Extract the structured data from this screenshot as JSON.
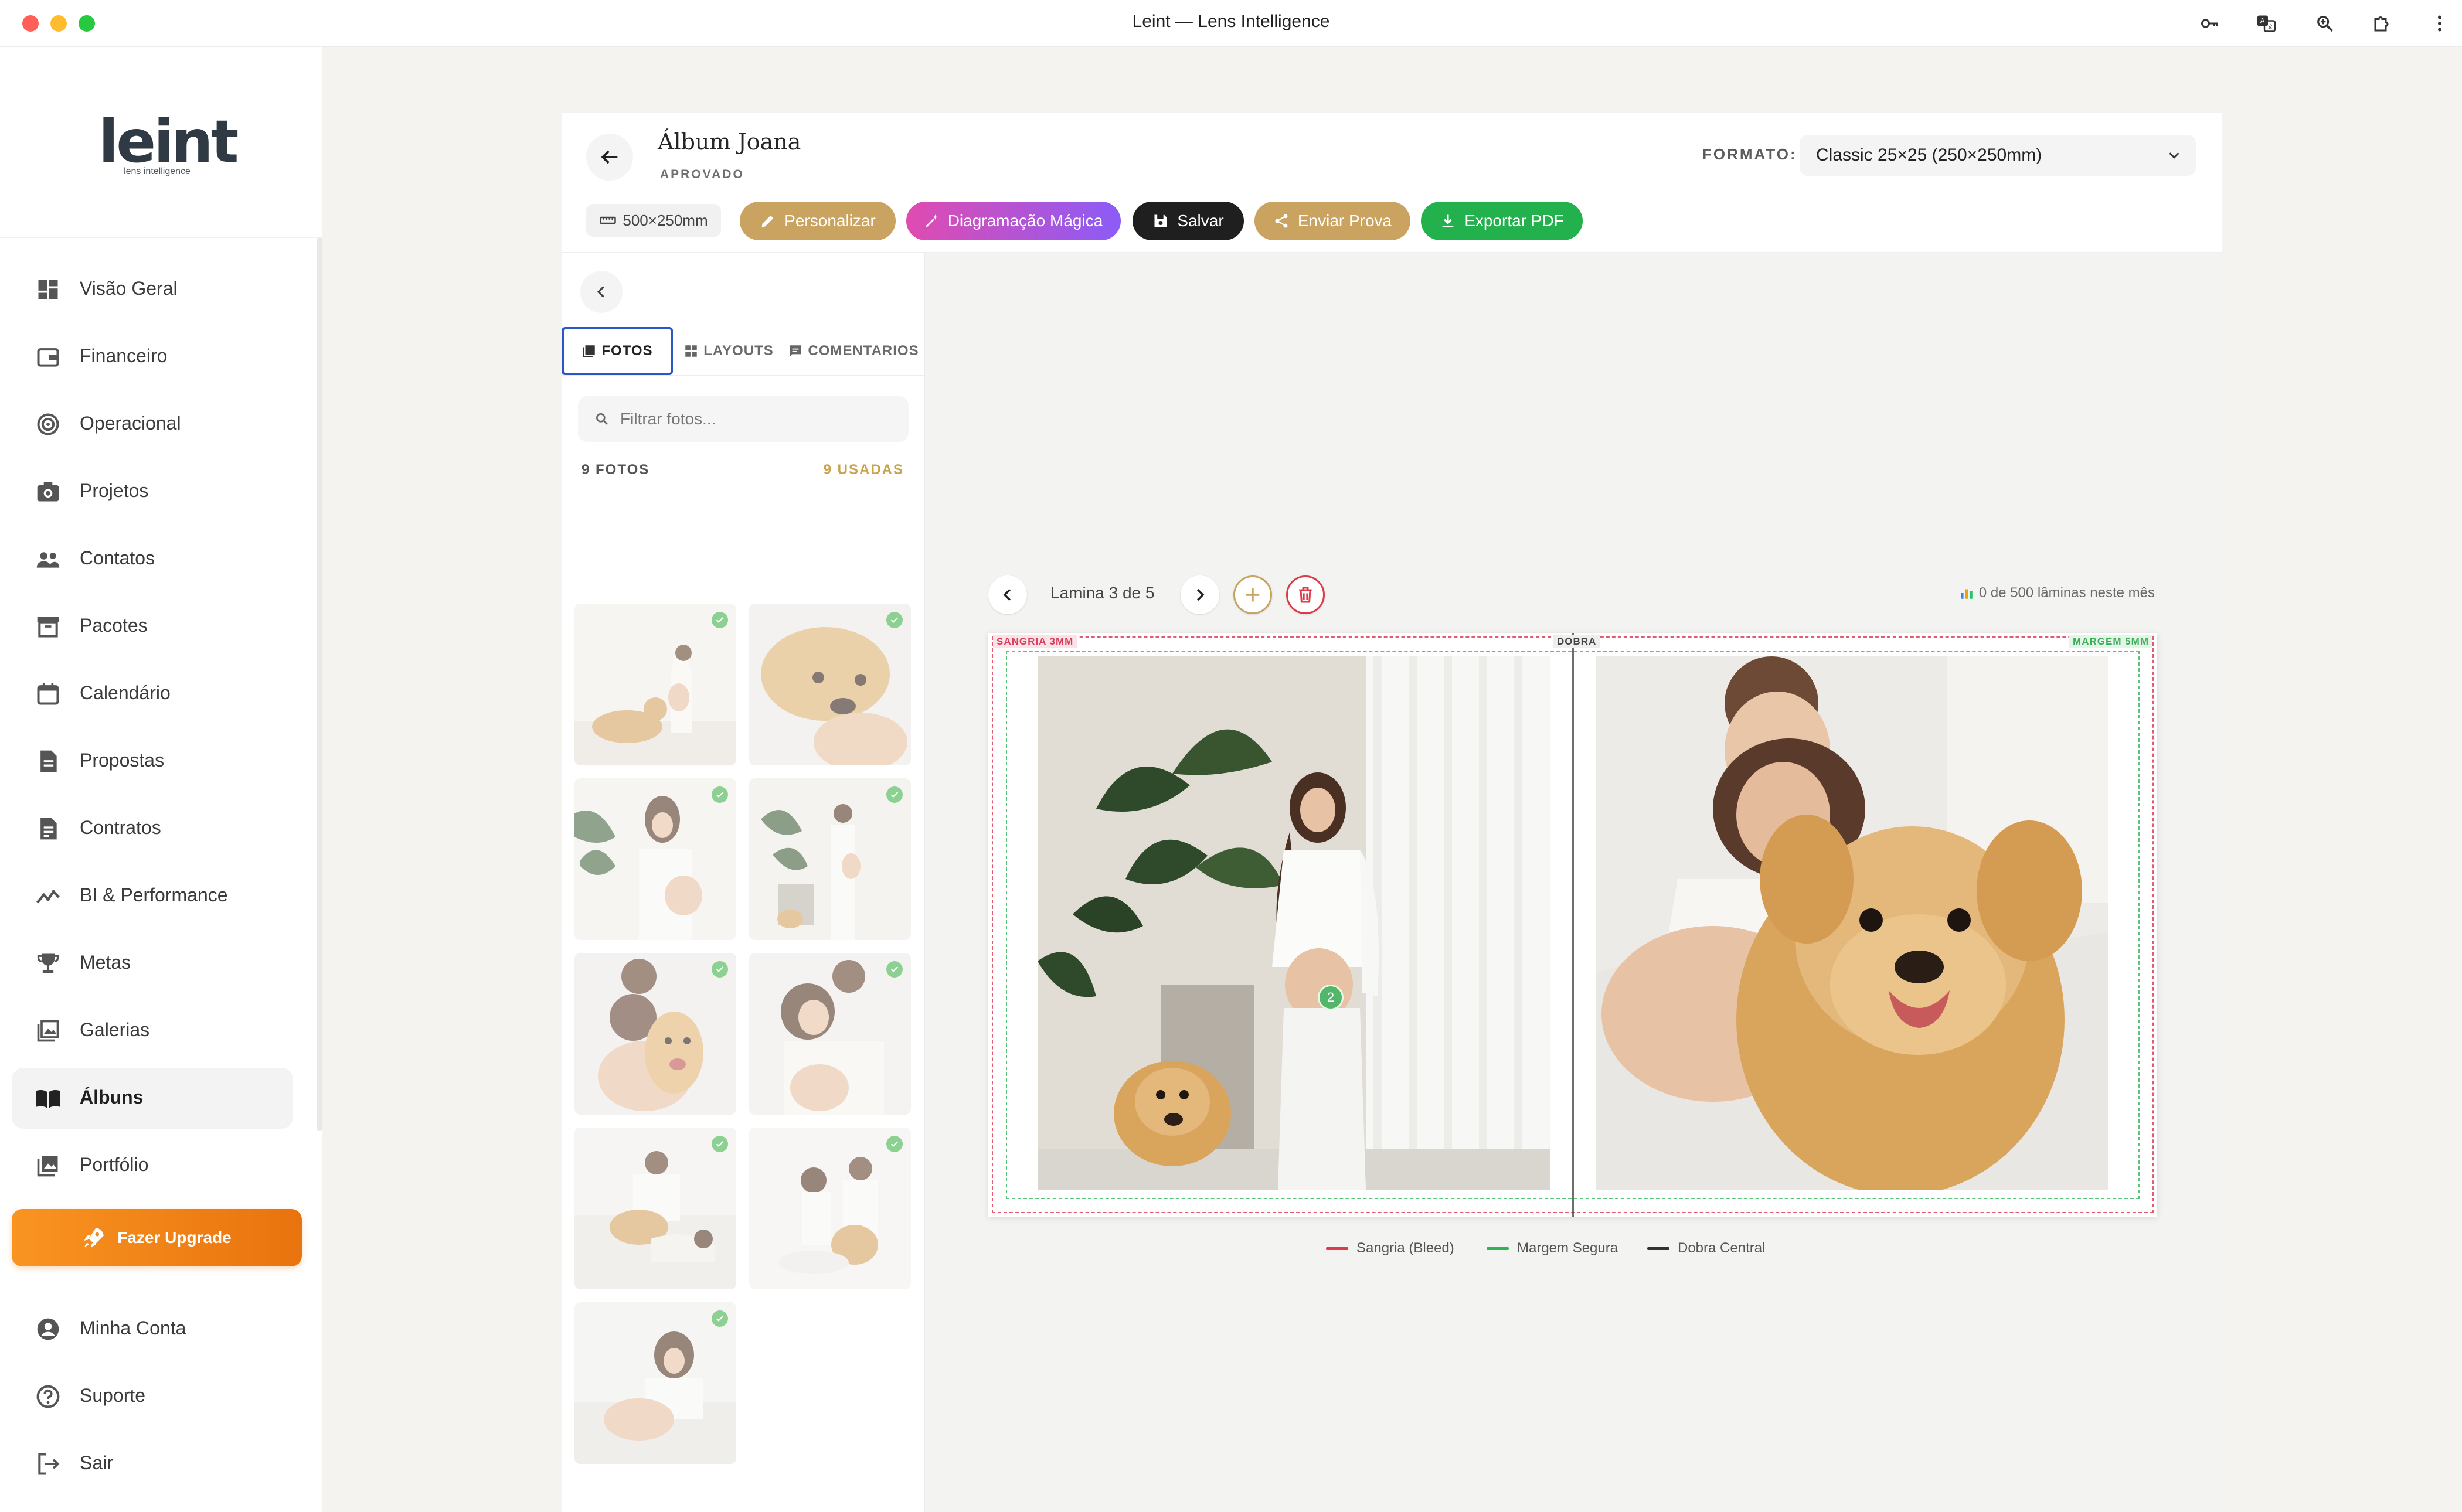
{
  "window": {
    "title": "Leint — Lens Intelligence"
  },
  "brand": {
    "name": "leint",
    "tagline": "lens intelligence"
  },
  "sidebar": {
    "items": [
      {
        "label": "Visão Geral",
        "icon": "dashboard-icon"
      },
      {
        "label": "Financeiro",
        "icon": "wallet-icon"
      },
      {
        "label": "Operacional",
        "icon": "target-icon"
      },
      {
        "label": "Projetos",
        "icon": "camera-icon"
      },
      {
        "label": "Contatos",
        "icon": "people-icon"
      },
      {
        "label": "Pacotes",
        "icon": "archive-icon"
      },
      {
        "label": "Calendário",
        "icon": "calendar-icon"
      },
      {
        "label": "Propostas",
        "icon": "document-icon"
      },
      {
        "label": "Contratos",
        "icon": "contract-icon"
      },
      {
        "label": "BI & Performance",
        "icon": "trend-icon"
      },
      {
        "label": "Metas",
        "icon": "trophy-icon"
      },
      {
        "label": "Galerias",
        "icon": "gallery-icon"
      },
      {
        "label": "Álbuns",
        "icon": "book-icon",
        "active": true
      },
      {
        "label": "Portfólio",
        "icon": "portfolio-icon"
      }
    ],
    "upgrade_label": "Fazer Upgrade",
    "footer_items": [
      {
        "label": "Minha Conta",
        "icon": "account-icon"
      },
      {
        "label": "Suporte",
        "icon": "help-icon"
      },
      {
        "label": "Sair",
        "icon": "logout-icon"
      }
    ]
  },
  "header": {
    "album_title": "Álbum Joana",
    "status": "APROVADO",
    "format_label": "FORMATO:",
    "format_value": "Classic 25×25 (250×250mm)",
    "size_chip": "500×250mm",
    "buttons": {
      "personalize": "Personalizar",
      "magic": "Diagramação Mágica",
      "save": "Salvar",
      "send_proof": "Enviar Prova",
      "export_pdf": "Exportar PDF"
    }
  },
  "panel": {
    "tabs": [
      "FOTOS",
      "LAYOUTS",
      "COMENTARIOS"
    ],
    "filter_placeholder": "Filtrar fotos...",
    "photo_count": "9 FOTOS",
    "used_count": "9 USADAS"
  },
  "editor": {
    "lamina_label": "Lamina 3 de 5",
    "quota_text": "0 de 500 lâminas neste mês",
    "tags": {
      "bleed": "SANGRIA 3MM",
      "fold": "DOBRA",
      "margin": "MARGEM 5MM"
    },
    "photo_badge": "2",
    "legend": {
      "bleed": "Sangria (Bleed)",
      "safe": "Margem Segura",
      "fold": "Dobra Central"
    }
  },
  "colors": {
    "personalize": "#c9a35f",
    "magic_from": "#e04bb0",
    "magic_to": "#8b5cf6",
    "save": "#1f1f1f",
    "send_proof": "#c9a35f",
    "export_pdf": "#22b14c",
    "upgrade": "#f08a1a",
    "bleed_line": "#e25b73",
    "safe_line": "#5ac37a",
    "fold_line": "#444444"
  }
}
